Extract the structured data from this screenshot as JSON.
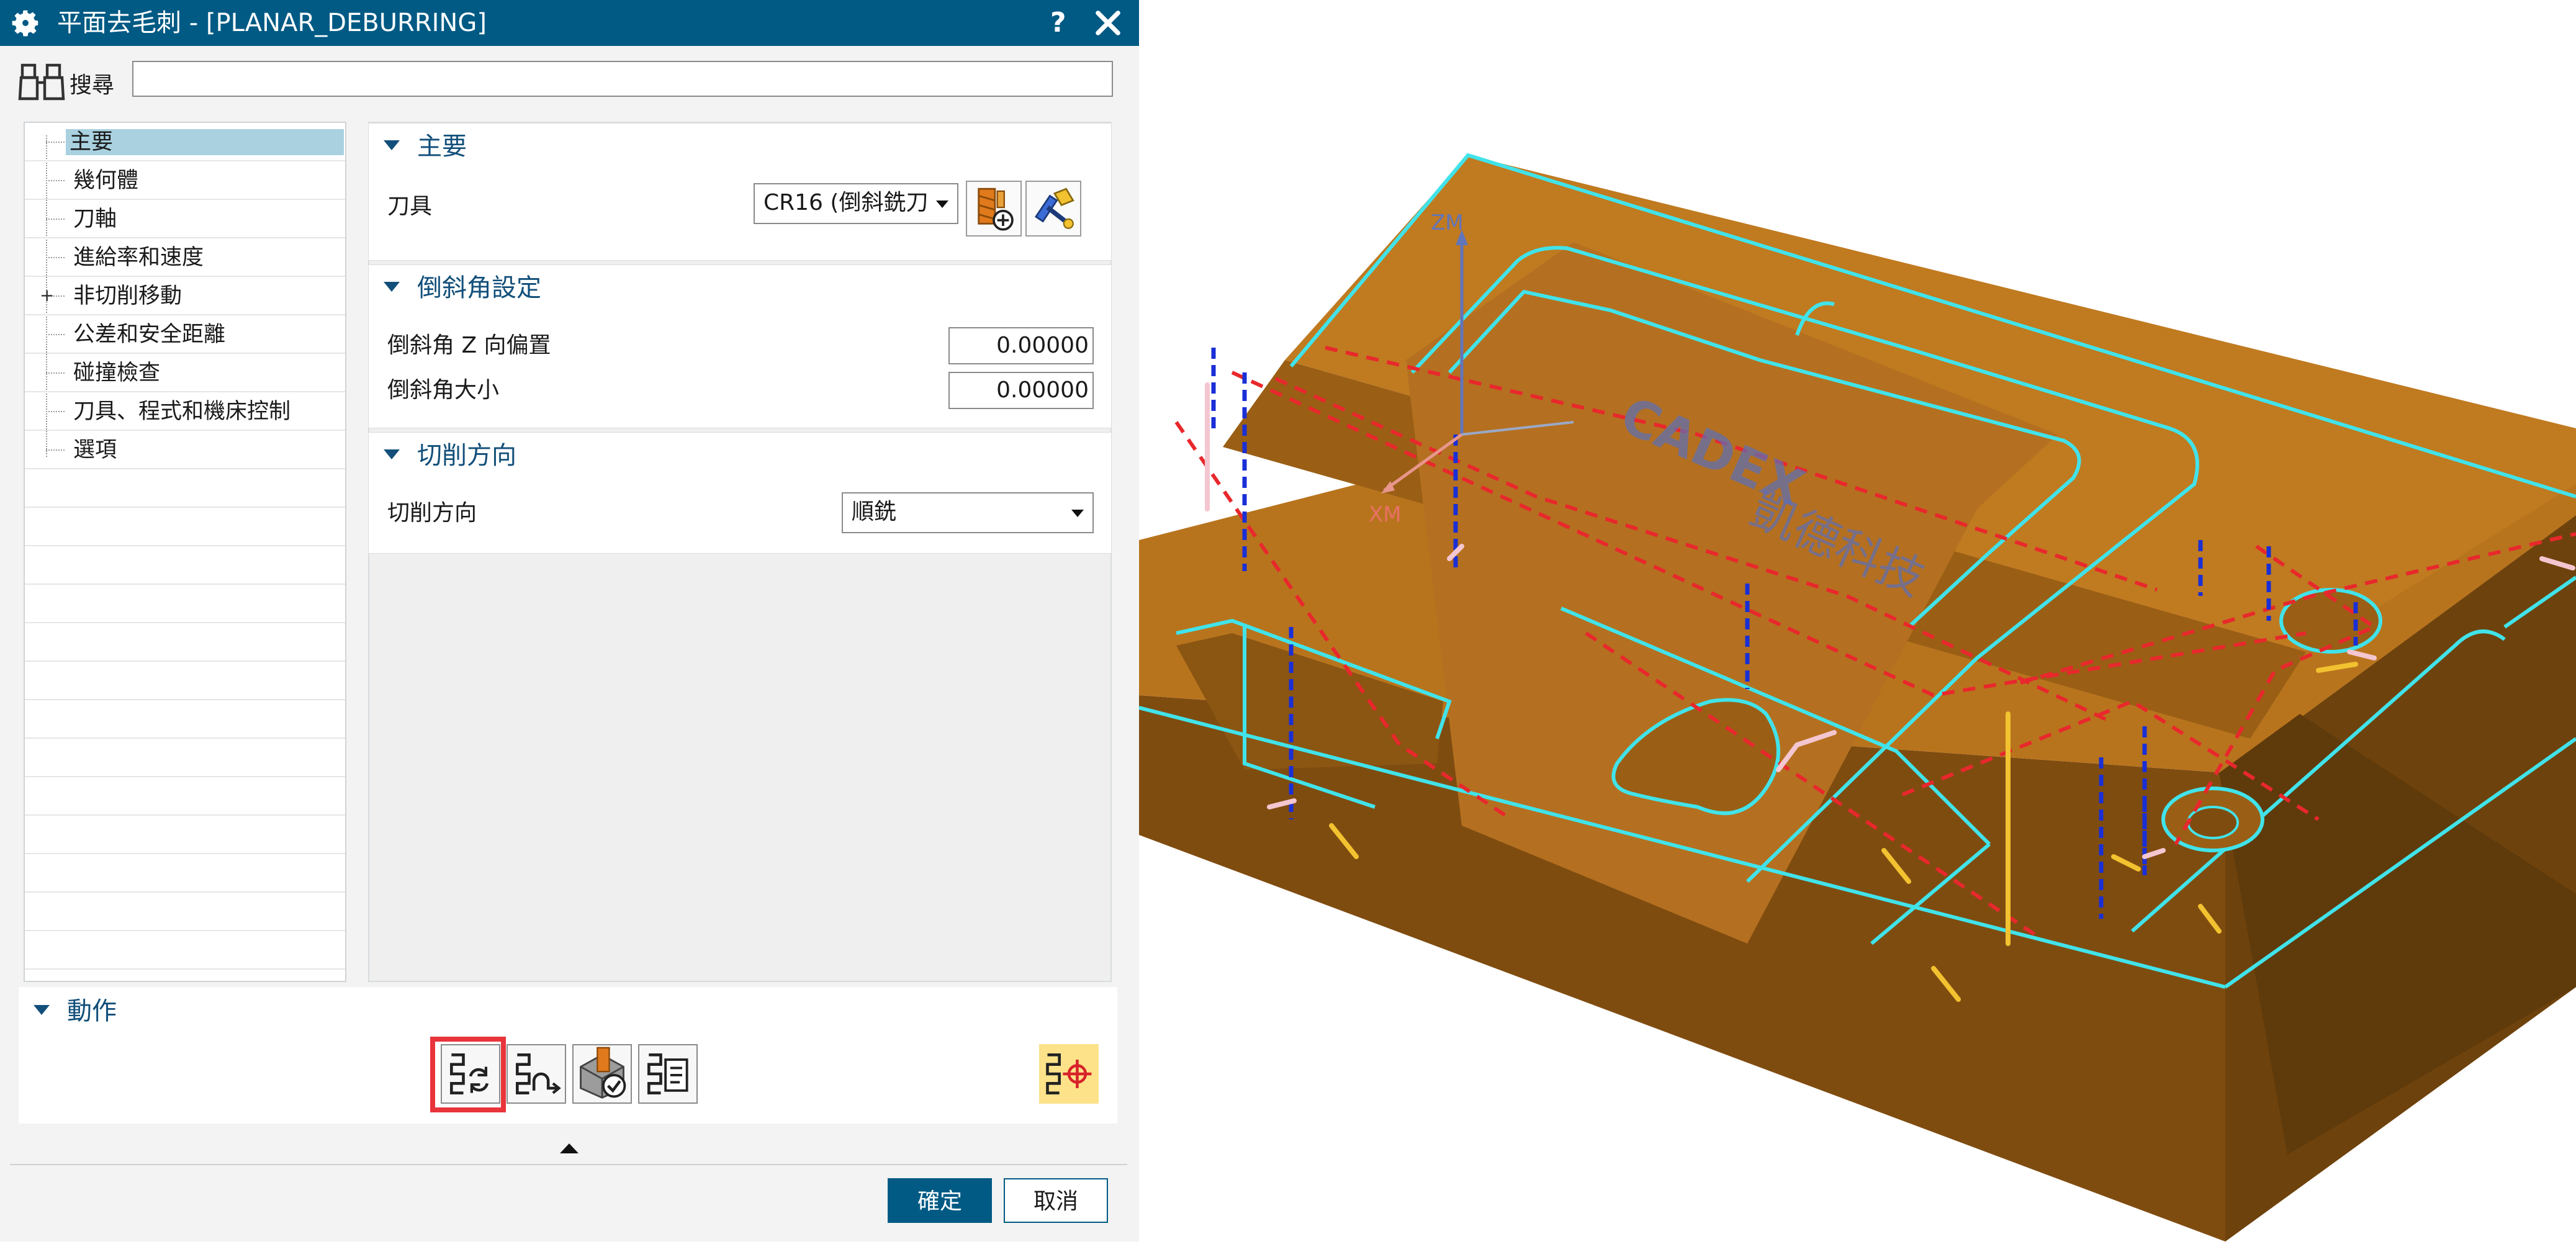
{
  "dialog": {
    "title": "平面去毛刺 - [PLANAR_DEBURRING]",
    "help_symbol": "?",
    "search_label": "搜尋",
    "search_value": ""
  },
  "nav": {
    "items": [
      {
        "label": "主要",
        "selected": true
      },
      {
        "label": "幾何體"
      },
      {
        "label": "刀軸"
      },
      {
        "label": "進給率和速度"
      },
      {
        "label": "非切削移動",
        "expandable": true
      },
      {
        "label": "公差和安全距離"
      },
      {
        "label": "碰撞檢查"
      },
      {
        "label": "刀具、程式和機床控制"
      },
      {
        "label": "選項"
      }
    ]
  },
  "main": {
    "header": "主要",
    "tool_label": "刀具",
    "tool_value": "CR16 (倒斜銑刀"
  },
  "chamfer": {
    "header": "倒斜角設定",
    "z_offset_label": "倒斜角 Z 向偏置",
    "z_offset_value": "0.00000",
    "size_label": "倒斜角大小",
    "size_value": "0.00000"
  },
  "cut": {
    "header": "切削方向",
    "direction_label": "切削方向",
    "direction_value": "順銑"
  },
  "actions": {
    "header": "動作",
    "buttons": [
      "generate-icon",
      "replay-icon",
      "verify-icon",
      "list-icon",
      "display-feature-icon"
    ]
  },
  "footer": {
    "ok": "確定",
    "cancel": "取消"
  },
  "viewport": {
    "axis_z": "ZM",
    "axis_x": "XM",
    "watermark_en": "CADEX",
    "watermark_zh": "凱德科技",
    "colors": {
      "part": "#b8741d",
      "part_dark": "#7f4c10",
      "edge": "#41e3ea",
      "path": "#e8282c",
      "plunge": "#1a2fd6",
      "engage": "#f2c230",
      "retract": "#f4c6cf",
      "axis": "#6275b9"
    }
  }
}
